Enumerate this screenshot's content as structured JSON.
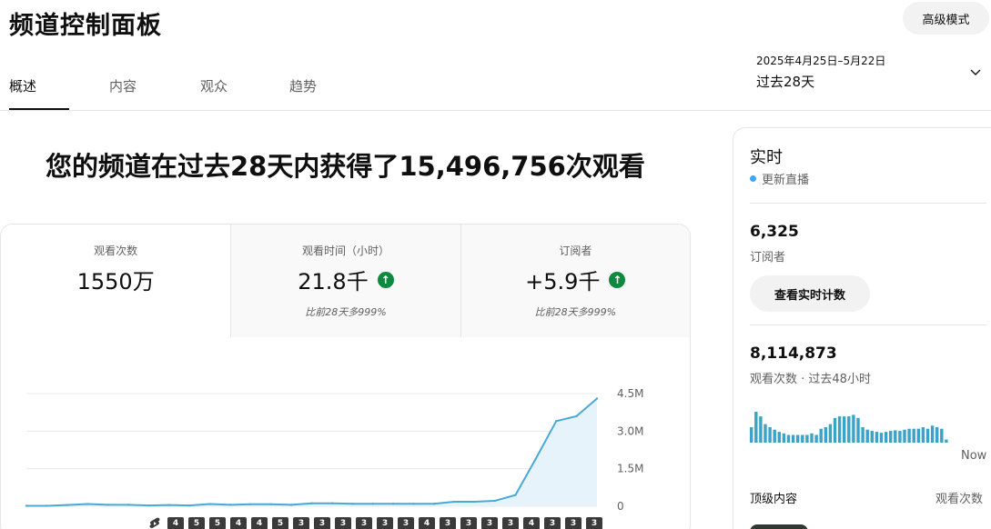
{
  "header": {
    "title": "频道控制面板",
    "advanced_mode_label": "高级模式"
  },
  "tabs": [
    {
      "label": "概述",
      "active": true
    },
    {
      "label": "内容",
      "active": false
    },
    {
      "label": "观众",
      "active": false
    },
    {
      "label": "趋势",
      "active": false
    }
  ],
  "date_range": {
    "range": "2025年4月25日–5月22日",
    "period": "过去28天"
  },
  "headline": "您的频道在过去28天内获得了15,496,756次观看",
  "stats": [
    {
      "label": "观看次数",
      "value": "1550万",
      "trend": null,
      "compare": ""
    },
    {
      "label": "观看时间（小时）",
      "value": "21.8千",
      "trend": "up",
      "compare": "比前28天多999%"
    },
    {
      "label": "订阅者",
      "value": "+5.9千",
      "trend": "up",
      "compare": "比前28天多999%"
    }
  ],
  "colors": {
    "trend_up": "#0e8a3e",
    "chart_line": "#4aa8d8",
    "chart_fill": "#e6f3fa",
    "live_dot": "#3ea6ff",
    "realtime_bars": "#3aa3c8",
    "badge_bg": "#3a3a3a"
  },
  "chart_data": {
    "type": "area",
    "series": [
      {
        "values": [
          0.02,
          0.02,
          0.05,
          0.09,
          0.06,
          0.06,
          0.03,
          0.05,
          0.03,
          0.09,
          0.06,
          0.08,
          0.08,
          0.06,
          0.12,
          0.12,
          0.1,
          0.1,
          0.1,
          0.1,
          0.1,
          0.18,
          0.18,
          0.22,
          0.45,
          1.9,
          3.4,
          3.6,
          4.3
        ]
      }
    ],
    "ylim": [
      0,
      4.5
    ],
    "yticks": [
      "4.5M",
      "3.0M",
      "1.5M",
      "0"
    ],
    "ytick_values": [
      4.5,
      3.0,
      1.5,
      0
    ],
    "grid": true
  },
  "video_badges": {
    "icon": "shorts-icon",
    "counts": [
      "4",
      "5",
      "5",
      "4",
      "4",
      "5",
      "3",
      "3",
      "3",
      "3",
      "3",
      "3",
      "4",
      "3",
      "3",
      "3",
      "3",
      "4",
      "3",
      "3",
      "3"
    ]
  },
  "realtime": {
    "title": "实时",
    "live_label": "更新直播",
    "subscribers_value": "6,325",
    "subscribers_label": "订阅者",
    "button_label": "查看实时计数",
    "views_value": "8,114,873",
    "views_label": "观看次数 · 过去48小时",
    "now_label": "Now",
    "top_content_label": "顶级内容",
    "top_content_views_label": "观看次数",
    "bars": [
      0.5,
      1.0,
      0.85,
      0.6,
      0.5,
      0.42,
      0.35,
      0.3,
      0.25,
      0.25,
      0.25,
      0.25,
      0.25,
      0.3,
      0.25,
      0.45,
      0.5,
      0.6,
      0.8,
      0.85,
      0.85,
      0.85,
      0.9,
      0.8,
      0.5,
      0.42,
      0.38,
      0.35,
      0.32,
      0.35,
      0.38,
      0.4,
      0.38,
      0.42,
      0.45,
      0.45,
      0.45,
      0.5,
      0.45,
      0.55,
      0.5,
      0.45,
      0.1
    ]
  }
}
